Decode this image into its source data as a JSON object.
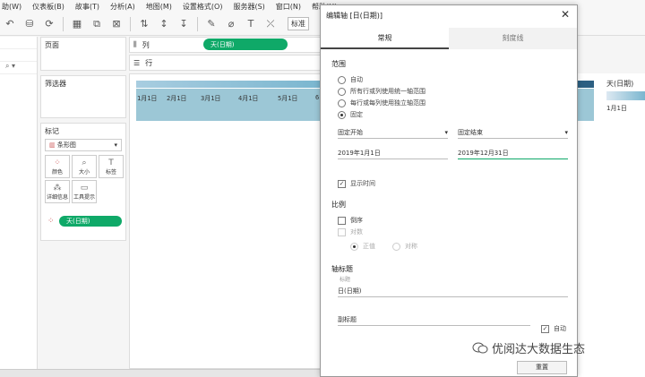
{
  "menu": [
    "助(W)",
    "仪表板(B)",
    "故事(T)",
    "分析(A)",
    "地图(M)",
    "设置格式(O)",
    "服务器(S)",
    "窗口(N)",
    "帮助(H)"
  ],
  "toolbar": {
    "standard_label": "标准"
  },
  "left": {
    "pages_title": "页面",
    "filters_title": "筛选器",
    "marks_title": "标记",
    "marks_type": "条形图",
    "marks_buttons": [
      {
        "label": "颜色",
        "icon": "color-dots-icon"
      },
      {
        "label": "大小",
        "icon": "size-icon"
      },
      {
        "label": "标签",
        "icon": "label-icon"
      },
      {
        "label": "详细信息",
        "icon": "detail-icon"
      },
      {
        "label": "工具提示",
        "icon": "tooltip-icon"
      }
    ],
    "marks_pill": "天(日期)"
  },
  "shelves": {
    "columns_label": "列",
    "rows_label": "行",
    "column_pill": "天(日期)"
  },
  "view": {
    "ticks": [
      "1月1日",
      "2月1日",
      "3月1日",
      "4月1日",
      "5月1日",
      "6"
    ]
  },
  "right_panel": {
    "title": "天(日期)",
    "label": "1月1日"
  },
  "dialog": {
    "title": "编辑轴 [日(日期)]",
    "tabs": [
      "常规",
      "刻度线"
    ],
    "range_title": "范围",
    "range_options": [
      "自动",
      "所有行或列使用统一轴范围",
      "每行或每列使用独立轴范围",
      "固定"
    ],
    "range_selected": 3,
    "fixed_start_label": "固定开始",
    "fixed_end_label": "固定结束",
    "start_value": "2019年1月1日",
    "end_value": "2019年12月31日",
    "show_time_label": "显示时间",
    "scale_title": "比例",
    "reverse_label": "倒序",
    "log_label": "对数",
    "positive_label": "正值",
    "symmetric_label": "对称",
    "axis_title_section": "轴标题",
    "title_field_label": "标题",
    "title_value": "日(日期)",
    "subtitle_placeholder": "副标题",
    "auto_label": "自动",
    "reset_label": "重置"
  },
  "watermark": "优阅达大数据生态"
}
